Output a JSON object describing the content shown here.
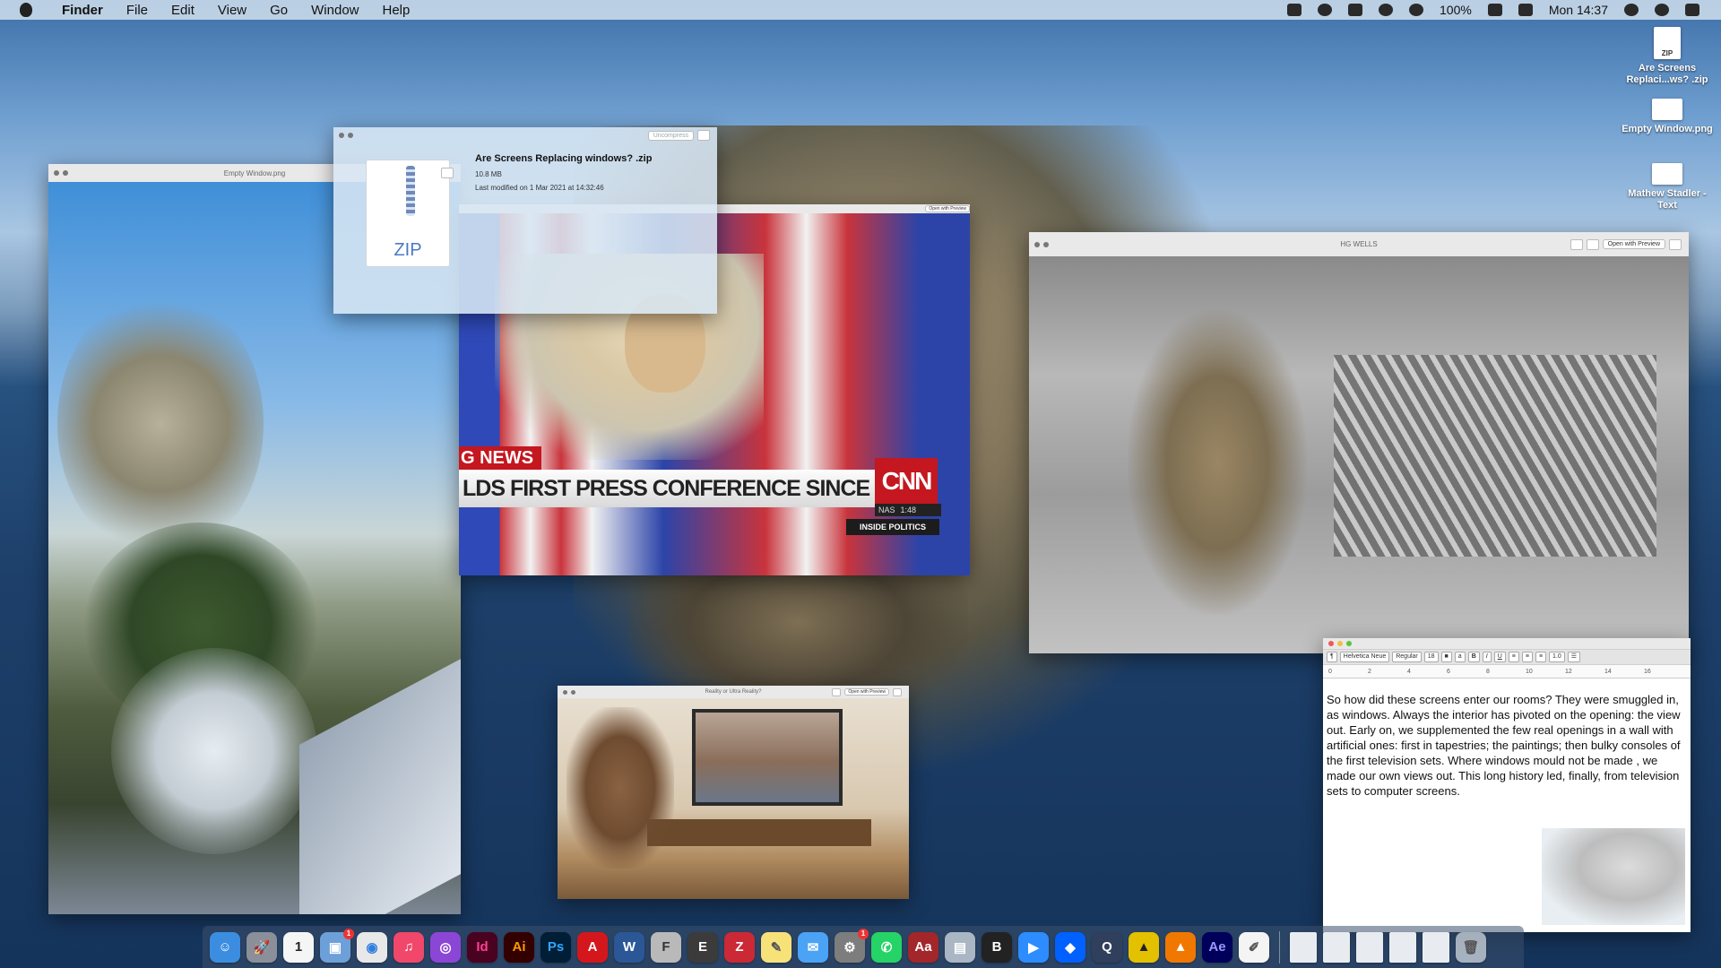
{
  "menubar": {
    "app": "Finder",
    "items": [
      "File",
      "Edit",
      "View",
      "Go",
      "Window",
      "Help"
    ],
    "battery": "100%",
    "clock": "Mon 14:37"
  },
  "desktop_icons": [
    {
      "label": "Are Screens Replaci...ws? .zip",
      "thumb": "ZIP"
    },
    {
      "label": "Empty Window.png"
    },
    {
      "label": "Mathew Stadler - Text"
    }
  ],
  "photo_window": {
    "title": "Empty Window.png"
  },
  "zip_window": {
    "uncompress": "Uncompress",
    "filename": "Are Screens Replacing windows? .zip",
    "size": "10.8 MB",
    "modified": "Last modified on 1 Mar 2021 at 14:32:46",
    "icon_text": "ZIP"
  },
  "cnn_window": {
    "open_btn": "Open with Preview",
    "news_label": "G NEWS",
    "chyron": "LDS FIRST PRESS CONFERENCE SINCE ELECTION",
    "logo": "CNN",
    "ticker_left": "NAS",
    "ticker_right": "1:48",
    "program": "INSIDE POLITICS"
  },
  "hg_window": {
    "title": "HG WELLS",
    "open_btn": "Open with Preview"
  },
  "reality_window": {
    "title": "Reality or Ultra Reality?",
    "open_btn": "Open with Preview"
  },
  "text_window": {
    "font": "Helvetica Neue",
    "style": "Regular",
    "size": "18",
    "spacing": "1.0",
    "ruler": [
      "0",
      "2",
      "4",
      "6",
      "8",
      "10",
      "12",
      "14",
      "16"
    ],
    "body": "So how did these screens enter our rooms? They were smuggled in, as windows. Always the interior has pivoted on the opening: the view out. Early on, we supplemented the few real openings in a wall with artificial ones: first in tapestries; the paintings;  then bulky consoles of the first television sets. Where windows mould not be made , we made our own views out. This long history led, finally, from television sets to computer screens."
  },
  "dock": {
    "apps": [
      {
        "name": "finder-icon",
        "glyph": "☺",
        "color": "#3b8de0"
      },
      {
        "name": "launchpad-icon",
        "glyph": "🚀",
        "color": "#8a8f99"
      },
      {
        "name": "calendar-icon",
        "glyph": "1",
        "color": "#f5f5f5",
        "fg": "#222"
      },
      {
        "name": "preview-photos-icon",
        "glyph": "▣",
        "color": "#6da0d8",
        "badge": "1"
      },
      {
        "name": "chrome-icon",
        "glyph": "◉",
        "color": "#e8e8e8",
        "fg": "#2f7de1"
      },
      {
        "name": "music-icon",
        "glyph": "♫",
        "color": "#f0476a"
      },
      {
        "name": "podcasts-icon",
        "glyph": "◎",
        "color": "#8c46d6"
      },
      {
        "name": "indesign-icon",
        "glyph": "Id",
        "color": "#49021f",
        "fg": "#ff3f94"
      },
      {
        "name": "illustrator-icon",
        "glyph": "Ai",
        "color": "#330000",
        "fg": "#ff9a00"
      },
      {
        "name": "photoshop-icon",
        "glyph": "Ps",
        "color": "#001e36",
        "fg": "#31a8ff"
      },
      {
        "name": "acrobat-icon",
        "glyph": "A",
        "color": "#d4171c"
      },
      {
        "name": "word-icon",
        "glyph": "W",
        "color": "#2b5797"
      },
      {
        "name": "fontbook-icon",
        "glyph": "F",
        "color": "#b9b9b9",
        "fg": "#333"
      },
      {
        "name": "exporter-icon",
        "glyph": "E",
        "color": "#3b3b3b"
      },
      {
        "name": "zotero-icon",
        "glyph": "Z",
        "color": "#cc2936"
      },
      {
        "name": "notes-icon",
        "glyph": "✎",
        "color": "#f7e27a",
        "fg": "#555"
      },
      {
        "name": "messages-icon",
        "glyph": "✉",
        "color": "#4aa3f5"
      },
      {
        "name": "system-preferences-icon",
        "glyph": "⚙",
        "color": "#7d7d7d",
        "badge": "1"
      },
      {
        "name": "whatsapp-icon",
        "glyph": "✆",
        "color": "#25d366"
      },
      {
        "name": "dictionary-icon",
        "glyph": "Aa",
        "color": "#a3262a"
      },
      {
        "name": "image-capture-icon",
        "glyph": "▤",
        "color": "#aab6c3"
      },
      {
        "name": "bbedit-icon",
        "glyph": "B",
        "color": "#222"
      },
      {
        "name": "zoom-icon",
        "glyph": "▶",
        "color": "#2d8cff"
      },
      {
        "name": "dropbox-icon",
        "glyph": "◆",
        "color": "#0061fe"
      },
      {
        "name": "quicktime-icon",
        "glyph": "Q",
        "color": "#2f3f5c"
      },
      {
        "name": "automator-icon",
        "glyph": "▲",
        "color": "#e3c000",
        "fg": "#222"
      },
      {
        "name": "vlc-icon",
        "glyph": "▲",
        "color": "#f07800"
      },
      {
        "name": "aftereffects-icon",
        "glyph": "Ae",
        "color": "#00005b",
        "fg": "#9999ff"
      },
      {
        "name": "textedit-icon",
        "glyph": "✐",
        "color": "#f4f4f4",
        "fg": "#555"
      }
    ],
    "stack_count": 5,
    "trash": "trash-icon"
  }
}
